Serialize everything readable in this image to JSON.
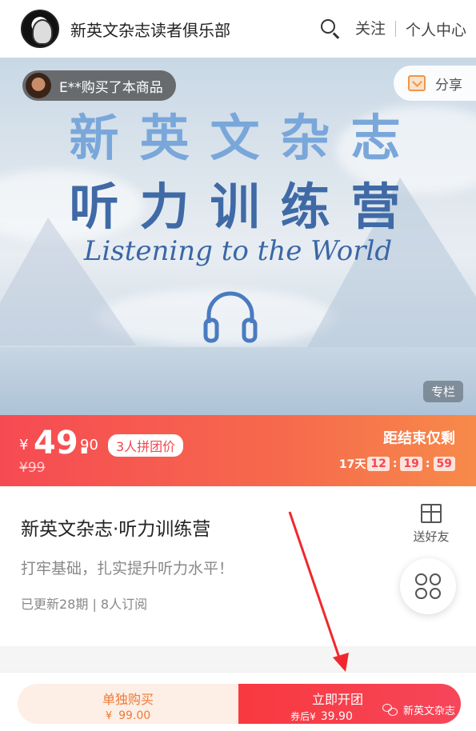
{
  "header": {
    "store_name": "新英文杂志读者俱乐部",
    "follow_label": "关注",
    "personal_center_label": "个人中心"
  },
  "banner": {
    "buyer_notice": "E**购买了本商品",
    "share_label": "分享",
    "title_line1": "新英文杂志",
    "title_line2": "听力训练营",
    "subtitle": "Listening to the World",
    "column_tag": "专栏"
  },
  "price": {
    "currency": "¥",
    "integer": "49.",
    "decimal": "90",
    "group_tag": "3人拼团价",
    "original": "¥99",
    "countdown_label": "距结束仅剩",
    "days": "17天",
    "hours": "12",
    "minutes": "19",
    "seconds": "59",
    "separator": ":"
  },
  "product": {
    "title": "新英文杂志·听力训练营",
    "description": "打牢基础，扎实提升听力水平！",
    "meta": "已更新28期 | 8人订阅",
    "gift_label": "送好友"
  },
  "bottom_bar": {
    "solo_label": "单独购买",
    "solo_currency": "¥",
    "solo_price": "99.00",
    "group_label": "立即开团",
    "group_prefix": "券后¥",
    "group_price": "39.90",
    "watermark": "新英文杂志"
  },
  "colors": {
    "accent_red": "#f5474f",
    "accent_orange": "#f07a35",
    "banner_blue": "#3f6aa6"
  }
}
